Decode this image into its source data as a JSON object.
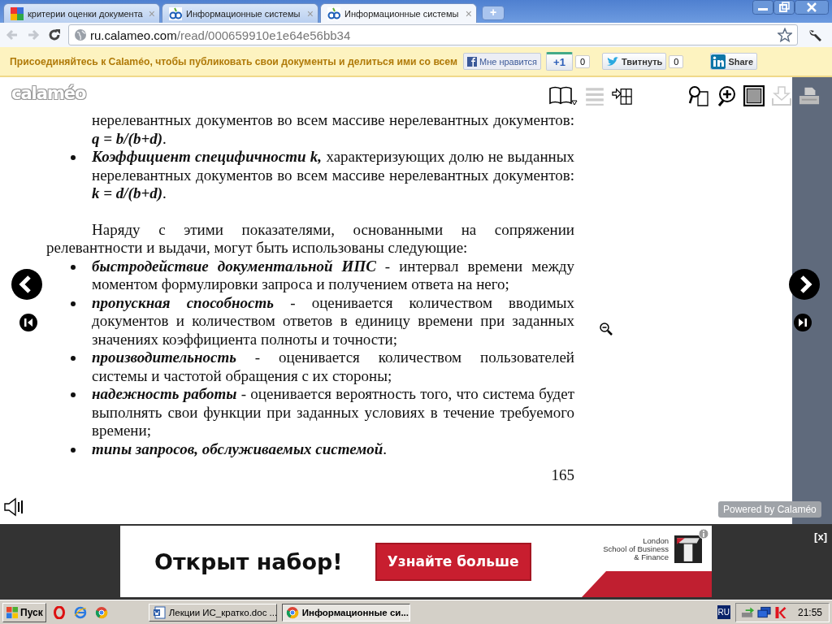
{
  "browser": {
    "tabs": [
      {
        "title": "критерии оценки документа",
        "kind": "search",
        "selected": false
      },
      {
        "title": "Информационные системы",
        "kind": "reader",
        "selected": false
      },
      {
        "title": "Информационные системы",
        "kind": "reader",
        "selected": true
      }
    ],
    "tab_close": "×",
    "new_tab": "+",
    "address": {
      "host": "ru.calameo.com",
      "path": "/read/000659910e1e64e56bb34"
    }
  },
  "infobar": {
    "message": "Присоединяйтесь к Calaméo, чтобы публиковать свои документы и делиться ими со всем",
    "like": "Мне нравится",
    "plus_one": "+1",
    "plus_count": "0",
    "tweet": "Твитнуть",
    "tweet_count": "0",
    "share": "Share"
  },
  "viewer": {
    "logo": "calaméo",
    "document": {
      "blocks": [
        {
          "kind": "continuation",
          "text": "нерелевантных документов во всем массиве нерелевантных документов: **q = b/(b+d)**."
        },
        {
          "kind": "bullet",
          "text": "**Коэффициент специфичности k,** характеризующих долю не выданных нерелевантных документов во всем массиве нерелевантных документов: **k = d/(b+d)**."
        },
        {
          "kind": "paragraph",
          "text": "Наряду с этими показателями, основанными на сопряжении релевантности и выдачи, могут быть использованы следующие:"
        },
        {
          "kind": "bullet",
          "text": "**быстродействие документальной ИПС** - интервал времени между моментом формулировки запроса и получением ответа на него;"
        },
        {
          "kind": "bullet",
          "text": "**пропускная способность** - оценивается количеством вводимых документов и количеством ответов в единицу времени при заданных значениях коэффициента полноты и точности;"
        },
        {
          "kind": "bullet",
          "text": "**производительность** - оценивается количеством пользователей системы и частотой обращения с их стороны;"
        },
        {
          "kind": "bullet",
          "text": "**надежность работы** - оценивается вероятность того, что система будет выполнять свои функции при заданных условиях в течение требуемого времени;"
        },
        {
          "kind": "bullet",
          "text": "**типы запросов, обслуживаемых системой**."
        }
      ],
      "page_number": "165"
    },
    "powered_by": "Powered by Calaméo"
  },
  "ad": {
    "headline": "Открыт набор!",
    "button": "Узнайте больше",
    "brand": [
      "London",
      "School of Business",
      "& Finance"
    ],
    "close": "[x]"
  },
  "taskbar": {
    "start": "Пуск",
    "tasks": [
      {
        "label": "Лекции ИС_кратко.doc ...",
        "kind": "document",
        "selected": false
      },
      {
        "label": "Информационные си...",
        "kind": "browser",
        "selected": true
      }
    ],
    "language": "RU",
    "clock": "21:55"
  }
}
